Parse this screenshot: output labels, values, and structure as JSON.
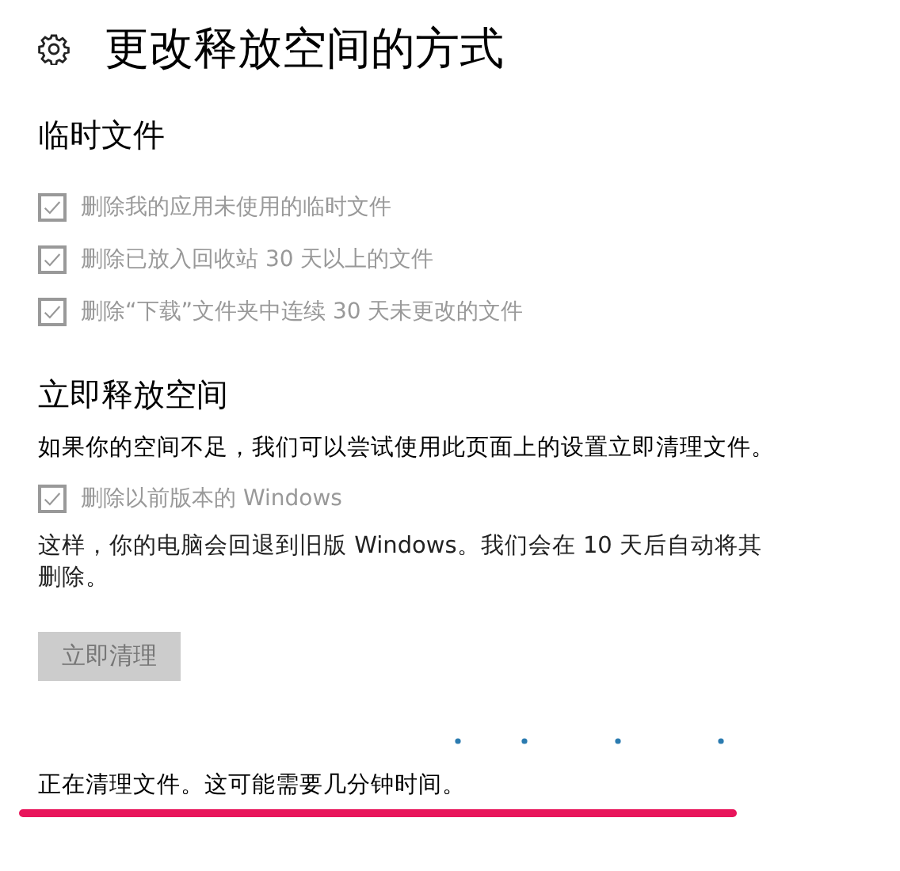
{
  "page": {
    "title": "更改释放空间的方式"
  },
  "temp_files": {
    "heading": "临时文件",
    "options": [
      {
        "label": "删除我的应用未使用的临时文件",
        "checked": true,
        "disabled": true
      },
      {
        "label": "删除已放入回收站 30 天以上的文件",
        "checked": true,
        "disabled": true
      },
      {
        "label": "删除“下载”文件夹中连续 30 天未更改的文件",
        "checked": true,
        "disabled": true
      }
    ]
  },
  "free_now": {
    "heading": "立即释放空间",
    "description": "如果你的空间不足，我们可以尝试使用此页面上的设置立即清理文件。",
    "options": [
      {
        "label": "删除以前版本的 Windows",
        "checked": true,
        "disabled": true
      }
    ],
    "note": "这样，你的电脑会回退到旧版 Windows。我们会在 10 天后自动将其删除。",
    "button": {
      "label": "立即清理",
      "disabled": true
    },
    "status": "正在清理文件。这可能需要几分钟时间。"
  }
}
